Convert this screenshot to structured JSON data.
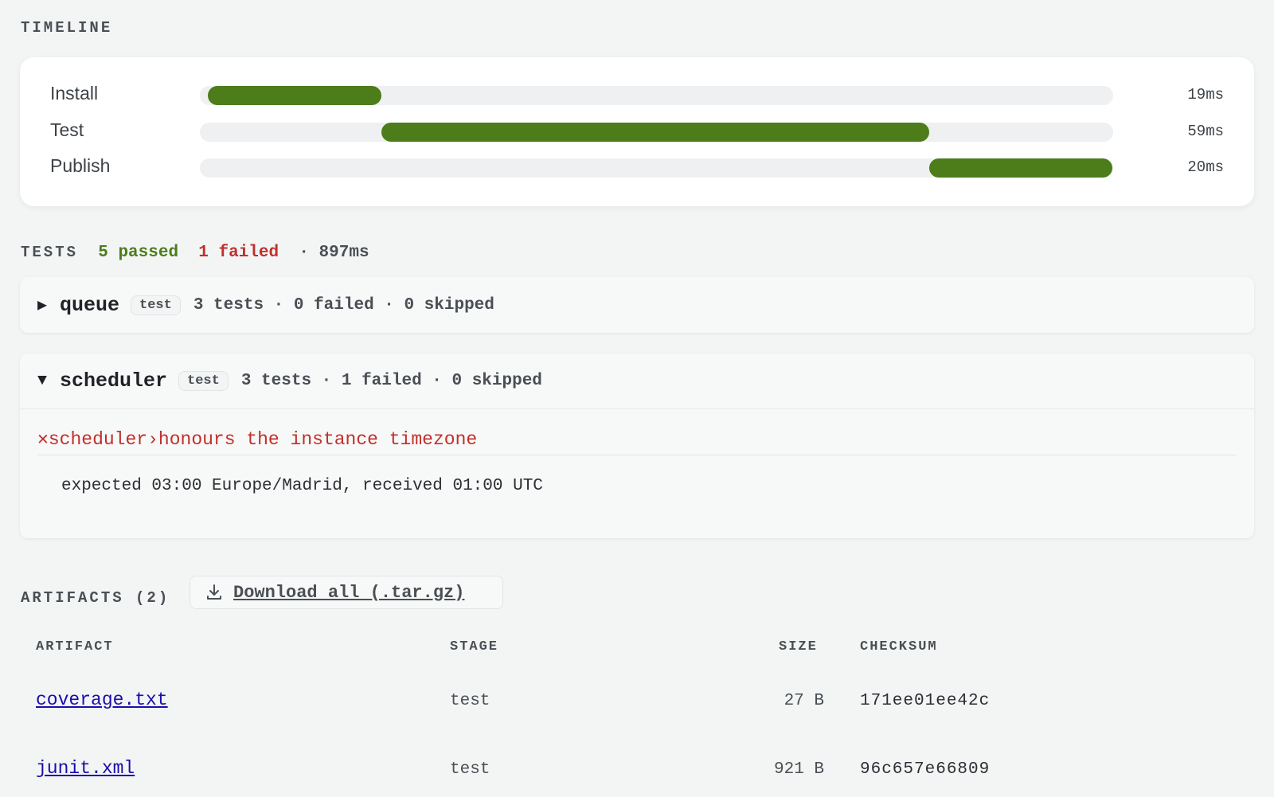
{
  "timeline": {
    "label": "TIMELINE",
    "rows": [
      {
        "name": "Install",
        "duration": "19ms",
        "start_fraction": 0.0,
        "end_fraction": 0.19
      },
      {
        "name": "Test",
        "duration": "59ms",
        "start_fraction": 0.19,
        "end_fraction": 0.79
      },
      {
        "name": "Publish",
        "duration": "20ms",
        "start_fraction": 0.79,
        "end_fraction": 0.99
      }
    ],
    "bar_color": "#4d7c1a"
  },
  "tests": {
    "label": "TESTS",
    "passed": "5 passed",
    "failed": "1 failed",
    "separator": "·",
    "duration": "897ms",
    "suites": [
      {
        "caret": "▶",
        "name": "queue",
        "stage": "test",
        "stats": "3 tests · 0 failed · 0 skipped"
      },
      {
        "caret": "▼",
        "name": "scheduler",
        "stage": "test",
        "stats": "3 tests · 1 failed · 0 skipped",
        "failure": {
          "icon": "✕",
          "suite": "scheduler",
          "arrow": "›",
          "test": "honours the instance timezone",
          "message": "expected 03:00 Europe/Madrid, received 01:00 UTC"
        }
      }
    ]
  },
  "artifacts": {
    "label": "ARTIFACTS",
    "count": "(2)",
    "download_label": "Download all (.tar.gz)",
    "columns": {
      "artifact": "ARTIFACT",
      "stage": "STAGE",
      "size": "SIZE",
      "checksum": "CHECKSUM"
    },
    "rows": [
      {
        "name": "coverage.txt",
        "stage": "test",
        "size": "27 B",
        "checksum": "171ee01ee42c"
      },
      {
        "name": "junit.xml",
        "stage": "test",
        "size": "921 B",
        "checksum": "96c657e66809"
      }
    ]
  },
  "colors": {
    "pass": "#4d7c1a",
    "fail": "#c0302b",
    "link": "#1a0dab"
  }
}
